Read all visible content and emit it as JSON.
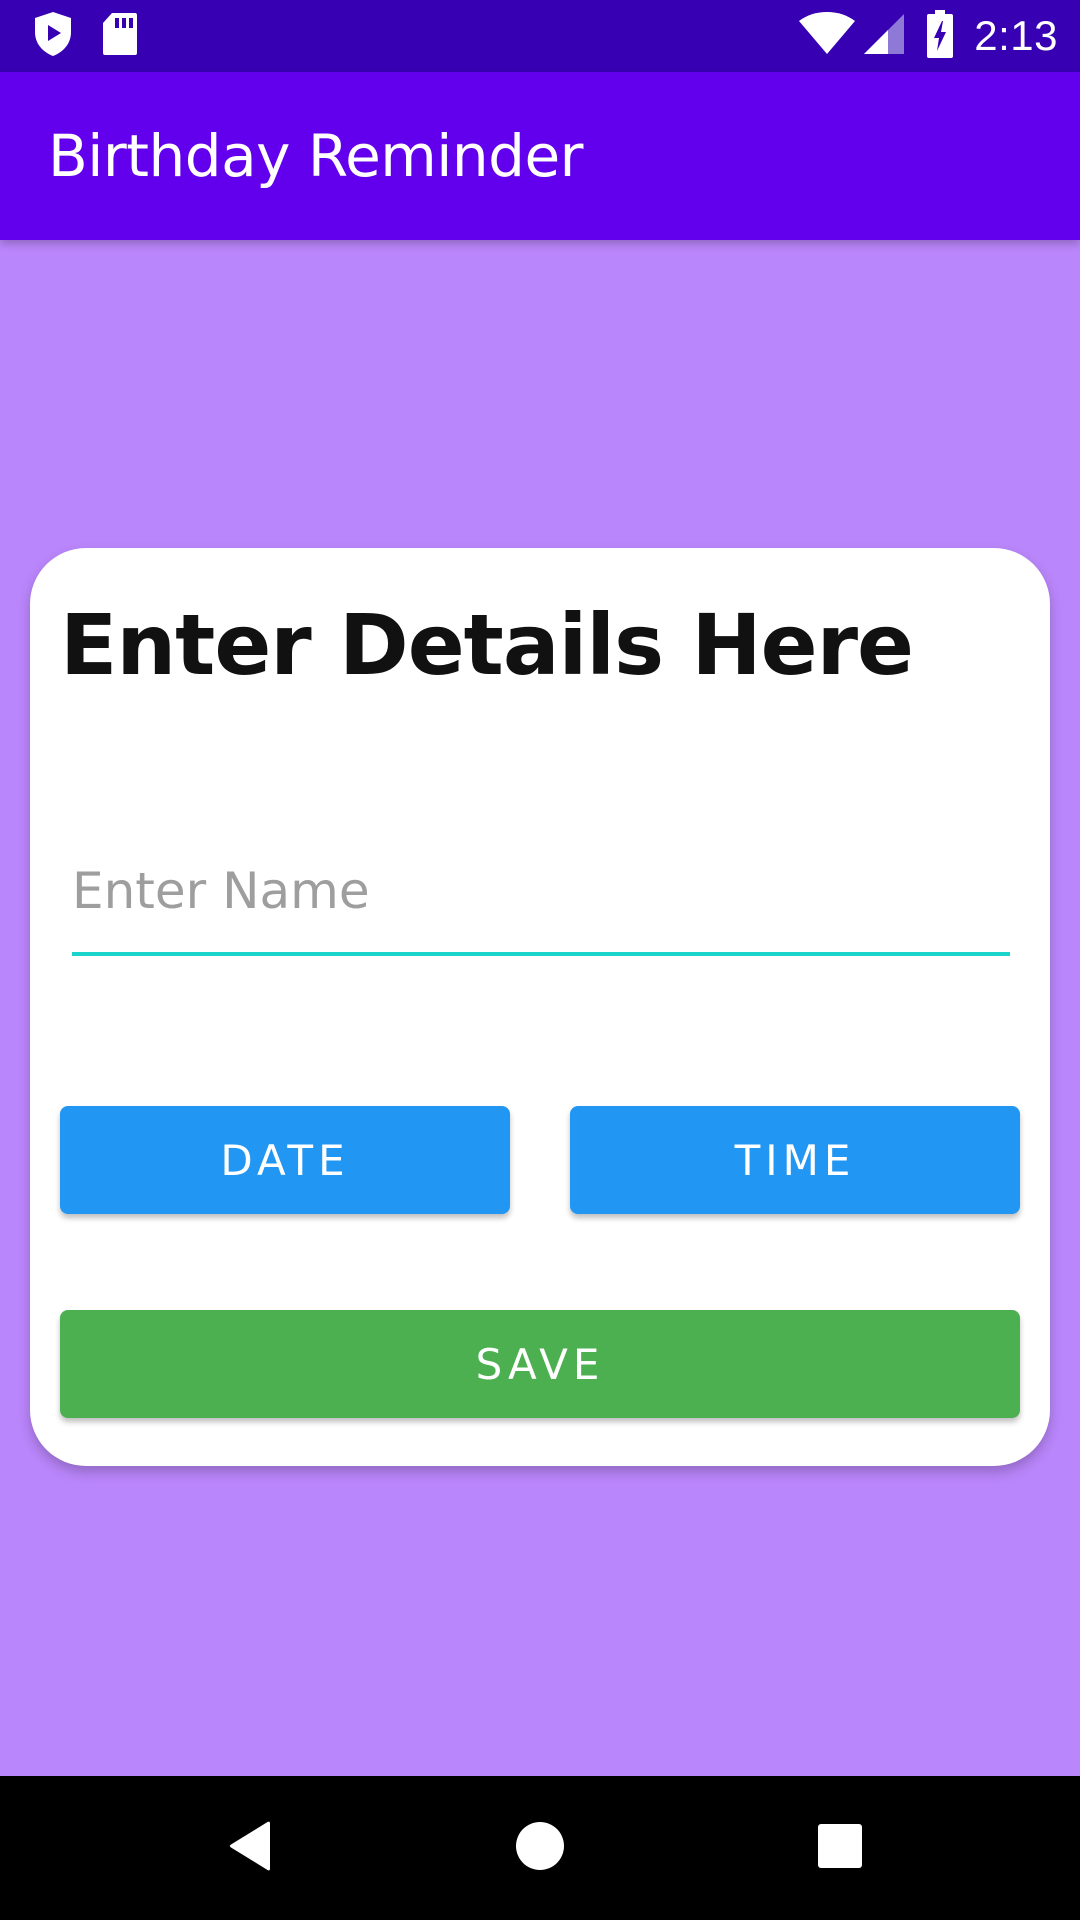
{
  "status_bar": {
    "time": "2:13",
    "icons": [
      "shield-play-icon",
      "sd-card-icon",
      "wifi-icon",
      "cell-signal-icon",
      "battery-charging-icon"
    ]
  },
  "app_bar": {
    "title": "Birthday Reminder"
  },
  "card": {
    "title": "Enter Details Here",
    "name_input": {
      "value": "",
      "placeholder": "Enter Name"
    },
    "date_button": "DATE",
    "time_button": "TIME",
    "save_button": "SAVE"
  },
  "nav_bar": {
    "icons": [
      "back-icon",
      "home-icon",
      "recents-icon"
    ]
  },
  "colors": {
    "status_bar": "#3700B3",
    "app_bar": "#6200EE",
    "background": "#BA86FB",
    "input_underline": "#1BD5CC",
    "date_time_buttons": "#2196F3",
    "save_button": "#4CAF50"
  }
}
